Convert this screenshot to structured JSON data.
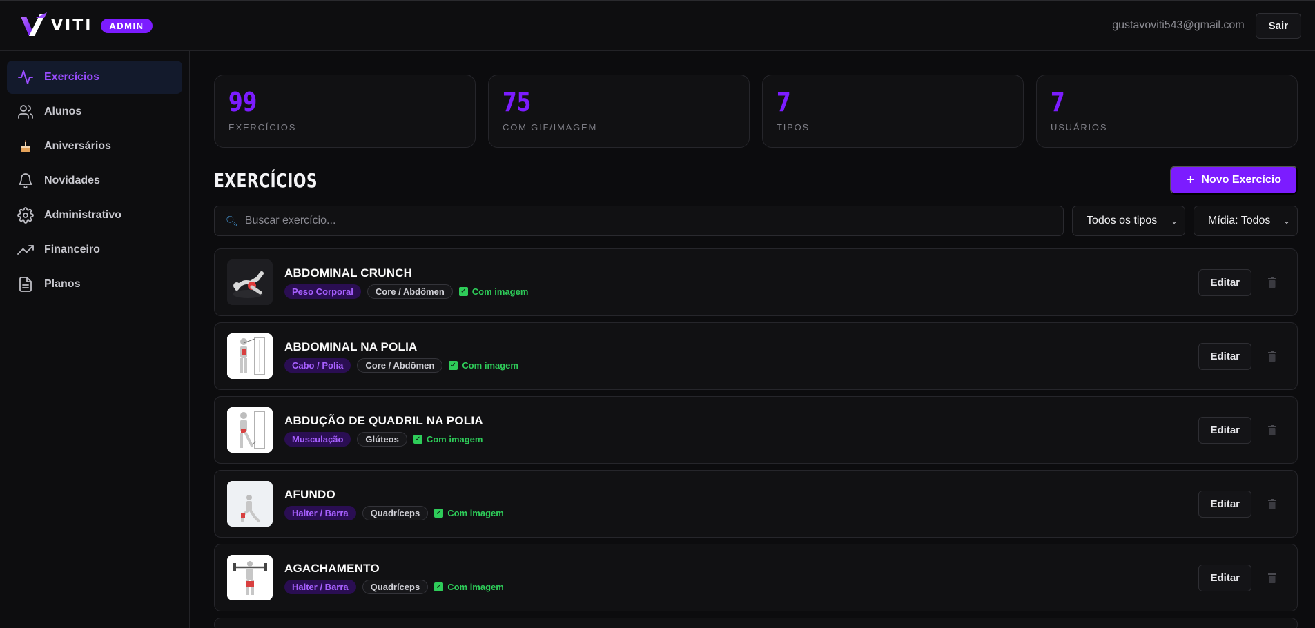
{
  "header": {
    "logo_text": "VITI",
    "badge": "ADMIN",
    "user_email": "gustavoviti543@gmail.com",
    "logout_label": "Sair"
  },
  "sidebar": {
    "items": [
      {
        "label": "Exercícios",
        "icon": "activity-icon",
        "active": true
      },
      {
        "label": "Alunos",
        "icon": "users-icon"
      },
      {
        "label": "Aniversários",
        "icon": "cake-icon"
      },
      {
        "label": "Novidades",
        "icon": "bell-icon"
      },
      {
        "label": "Administrativo",
        "icon": "gear-icon"
      },
      {
        "label": "Financeiro",
        "icon": "trending-up-icon"
      },
      {
        "label": "Planos",
        "icon": "document-icon"
      }
    ]
  },
  "stats": [
    {
      "value": "99",
      "label": "EXERCÍCIOS"
    },
    {
      "value": "75",
      "label": "COM GIF/IMAGEM"
    },
    {
      "value": "7",
      "label": "TIPOS"
    },
    {
      "value": "7",
      "label": "USUÁRIOS"
    }
  ],
  "section": {
    "title": "EXERCÍCIOS",
    "new_button": "Novo Exercício"
  },
  "filters": {
    "search_placeholder": "Buscar exercício...",
    "type_select": "Todos os tipos",
    "media_select": "Mídia: Todos"
  },
  "exercises": [
    {
      "name": "ABDOMINAL CRUNCH",
      "type": "Peso Corporal",
      "muscle": "Core / Abdômen",
      "media": "Com imagem",
      "edit": "Editar"
    },
    {
      "name": "ABDOMINAL NA POLIA",
      "type": "Cabo / Polia",
      "muscle": "Core / Abdômen",
      "media": "Com imagem",
      "edit": "Editar"
    },
    {
      "name": "ABDUÇÃO DE QUADRIL NA POLIA",
      "type": "Musculação",
      "muscle": "Glúteos",
      "media": "Com imagem",
      "edit": "Editar"
    },
    {
      "name": "AFUNDO",
      "type": "Halter / Barra",
      "muscle": "Quadríceps",
      "media": "Com imagem",
      "edit": "Editar"
    },
    {
      "name": "AGACHAMENTO",
      "type": "Halter / Barra",
      "muscle": "Quadríceps",
      "media": "Com imagem",
      "edit": "Editar"
    }
  ],
  "colors": {
    "accent": "#7c1cff",
    "success": "#2ecc59",
    "background": "#0c0c0e"
  }
}
